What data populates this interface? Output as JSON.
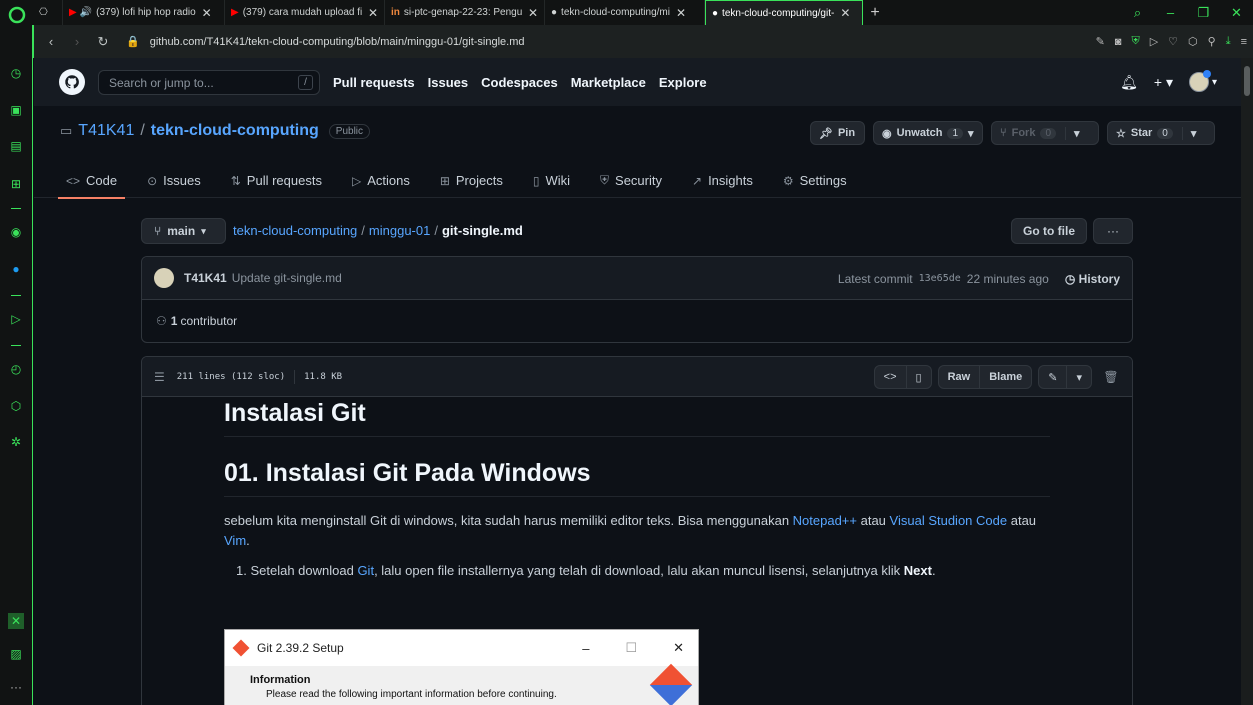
{
  "browser": {
    "tabs": [
      {
        "label": "(379) lofi hip hop radio",
        "icon": "youtube-icon",
        "audio": true
      },
      {
        "label": "(379) cara mudah upload fi",
        "icon": "youtube-icon"
      },
      {
        "label": "si-ptc-genap-22-23: Pengu",
        "icon": "site-icon"
      },
      {
        "label": "tekn-cloud-computing/mi",
        "icon": "github-icon"
      },
      {
        "label": "tekn-cloud-computing/git-",
        "icon": "github-icon",
        "active": true
      }
    ],
    "url": "github.com/T41K41/tekn-cloud-computing/blob/main/minggu-01/git-single.md",
    "accent_color": "#3ae25a"
  },
  "gh": {
    "search_placeholder": "Search or jump to...",
    "search_key": "/",
    "nav": [
      "Pull requests",
      "Issues",
      "Codespaces",
      "Marketplace",
      "Explore"
    ]
  },
  "repo": {
    "owner": "T41K41",
    "slash": "/",
    "name": "tekn-cloud-computing",
    "visibility": "Public",
    "pin": "Pin",
    "unwatch": "Unwatch",
    "watch_count": "1",
    "fork": "Fork",
    "fork_count": "0",
    "star": "Star",
    "star_count": "0",
    "tabs": [
      "Code",
      "Issues",
      "Pull requests",
      "Actions",
      "Projects",
      "Wiki",
      "Security",
      "Insights",
      "Settings"
    ]
  },
  "file": {
    "branch": "main",
    "crumb_repo": "tekn-cloud-computing",
    "crumb_dir": "minggu-01",
    "crumb_file": "git-single.md",
    "go_to_file": "Go to file",
    "more": "···",
    "commit_user": "T41K41",
    "commit_msg": "Update git-single.md",
    "latest_label": "Latest commit",
    "sha": "13e65de",
    "commit_time": "22 minutes ago",
    "history": "History",
    "contrib_count": "1",
    "contrib_label": "contributor",
    "lines": "211 lines (112 sloc)",
    "size": "11.8 KB",
    "raw": "Raw",
    "blame": "Blame"
  },
  "md": {
    "h1": "Instalasi Git",
    "h2": "01. Instalasi Git Pada Windows",
    "p1_a": "sebelum kita menginstall Git di windows, kita sudah harus memiliki editor teks. Bisa menggunakan ",
    "link_notepad": "Notepad++",
    "p1_b": " atau ",
    "link_vscode": "Visual Studion Code",
    "p1_c": " atau ",
    "link_vim": "Vim",
    "p1_d": ".",
    "li1_a": "1. Setelah download ",
    "link_git": "Git",
    "li1_b": ", lalu open file installernya yang telah di download, lalu akan muncul lisensi, selanjutnya klik ",
    "li1_bold": "Next",
    "li1_c": ".",
    "shot_title": "Git 2.39.2 Setup",
    "shot_info": "Information",
    "shot_info_sub": "Please read the following important information before continuing."
  }
}
